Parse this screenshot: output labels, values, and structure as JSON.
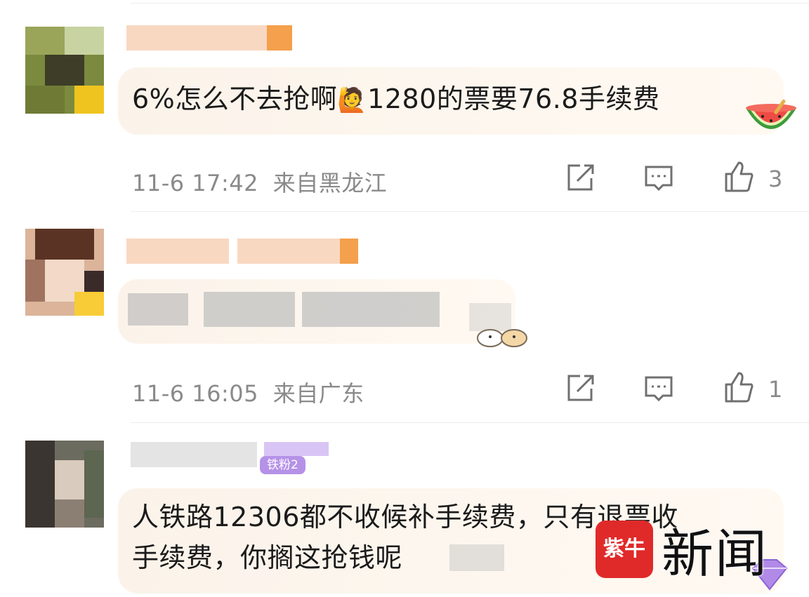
{
  "comments": [
    {
      "text": "6%怎么不去抢啊",
      "emoji": "🙋",
      "text_after": "1280的票要76.8手续费",
      "timestamp": "11-6 17:42",
      "location": "来自黑龙江",
      "likes": "3"
    },
    {
      "text_visible": "",
      "timestamp": "11-6 16:05",
      "location": "来自广东",
      "likes": "1"
    },
    {
      "fans_badge": "铁粉2",
      "text_line1": "人铁路12306都不收候补手续费，只有退票收",
      "text_line2": "手续费，你搁这抢钱呢"
    }
  ],
  "watermark": {
    "logo": "紫牛",
    "text": "新闻"
  },
  "icons": {
    "forward": "share-square-icon",
    "reply": "comment-bubble-icon",
    "like": "thumbs-up-icon"
  },
  "colors": {
    "meta": "#8a8a8a",
    "bubble": "#fbf3ea",
    "badge": "#b592e8",
    "watermark_red": "#e02a2a"
  }
}
